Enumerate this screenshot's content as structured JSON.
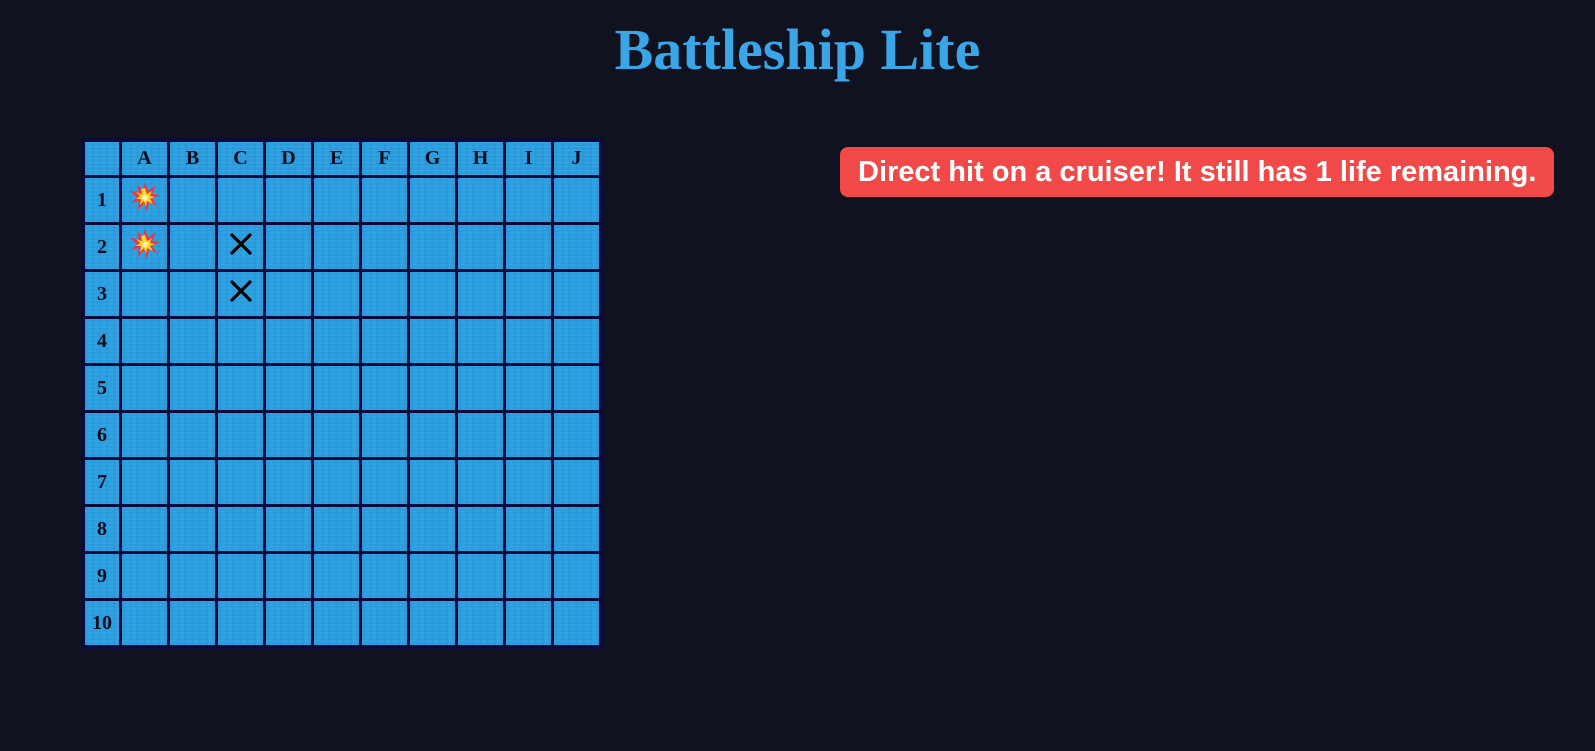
{
  "title": "Battleship Lite",
  "colors": {
    "background": "#10131f",
    "title": "#3aa6e8",
    "water": "#2a9ee0",
    "grid_line": "#0a0b3a",
    "status_background": "#f14848",
    "status_text": "#ffffff"
  },
  "board": {
    "columns": [
      "A",
      "B",
      "C",
      "D",
      "E",
      "F",
      "G",
      "H",
      "I",
      "J"
    ],
    "rows": [
      "1",
      "2",
      "3",
      "4",
      "5",
      "6",
      "7",
      "8",
      "9",
      "10"
    ],
    "shots": [
      {
        "cell": "A1",
        "result": "hit",
        "icon": "explosion-icon"
      },
      {
        "cell": "A2",
        "result": "hit",
        "icon": "explosion-icon"
      },
      {
        "cell": "C2",
        "result": "miss",
        "icon": "x-mark-icon"
      },
      {
        "cell": "C3",
        "result": "miss",
        "icon": "x-mark-icon"
      }
    ]
  },
  "status_message": "Direct hit on a cruiser! It still has 1 life remaining."
}
